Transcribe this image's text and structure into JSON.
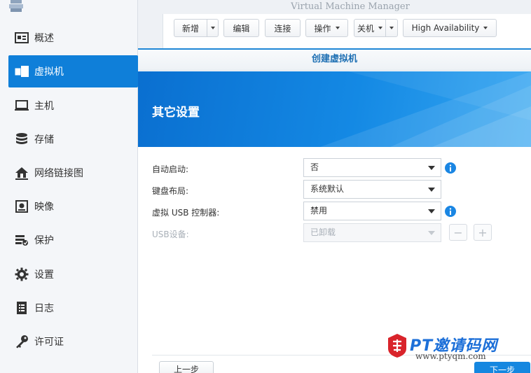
{
  "window": {
    "title": "Virtual Machine Manager"
  },
  "sidebar": {
    "items": [
      {
        "label": "概述",
        "icon": "overview-icon"
      },
      {
        "label": "虚拟机",
        "icon": "virtual-machine-icon",
        "active": true
      },
      {
        "label": "主机",
        "icon": "host-icon"
      },
      {
        "label": "存储",
        "icon": "storage-icon"
      },
      {
        "label": "网络链接图",
        "icon": "network-icon"
      },
      {
        "label": "映像",
        "icon": "image-icon"
      },
      {
        "label": "保护",
        "icon": "protection-icon"
      },
      {
        "label": "设置",
        "icon": "settings-icon"
      },
      {
        "label": "日志",
        "icon": "log-icon"
      },
      {
        "label": "许可证",
        "icon": "license-key-icon"
      }
    ]
  },
  "toolbar": {
    "add": "新增",
    "edit": "编辑",
    "connect": "连接",
    "action": "操作",
    "shutdown": "关机",
    "high_availability": "High Availability"
  },
  "dialog": {
    "title": "创建虚拟机",
    "banner_title": "其它设置",
    "rows": [
      {
        "label": "自动启动:",
        "value": "否",
        "info": true,
        "disabled": false
      },
      {
        "label": "键盘布局:",
        "value": "系统默认",
        "info": false,
        "disabled": false
      },
      {
        "label": "虚拟 USB 控制器:",
        "value": "禁用",
        "info": true,
        "disabled": false
      },
      {
        "label": "USB设备:",
        "value": "已卸载",
        "info": false,
        "disabled": true
      }
    ],
    "minus": "−",
    "plus": "+",
    "prev": "上一步",
    "next": "下一步"
  },
  "watermark": {
    "title": "PT邀请码网",
    "url": "www.ptyqm.com"
  },
  "colors": {
    "accent": "#0f7fd9",
    "banner": "#1489e4",
    "info": "#1a86e3"
  }
}
